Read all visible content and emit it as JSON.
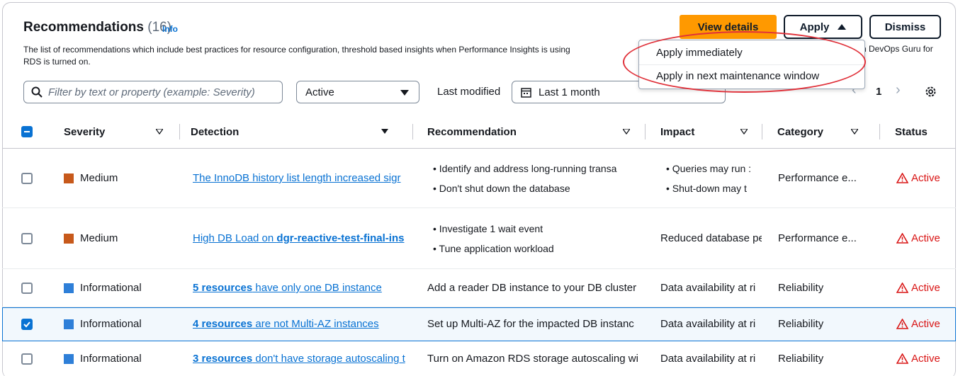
{
  "header": {
    "title": "Recommendations",
    "count": "(16)",
    "info": "Info",
    "description": "The list of recommendations which include best practices for resource configuration, threshold based insights when Performance Insights is using",
    "description_line2": "RDS is turned on.",
    "description_tail": "n DevOps Guru for"
  },
  "actions": {
    "view_details": "View details",
    "apply": "Apply",
    "dismiss": "Dismiss"
  },
  "apply_menu": {
    "items": [
      "Apply immediately",
      "Apply in next maintenance window"
    ]
  },
  "toolbar": {
    "filter_placeholder": "Filter by text or property (example: Severity)",
    "status_select": "Active",
    "last_modified_label": "Last modified",
    "date_range": "Last 1 month",
    "page": "1"
  },
  "columns": [
    "Severity",
    "Detection",
    "Recommendation",
    "Impact",
    "Category",
    "Status"
  ],
  "rows": [
    {
      "checked": false,
      "severity": "Medium",
      "severity_color": "#c7591b",
      "detection_bold": "",
      "detection": "The InnoDB history list length increased sigr",
      "recommendation": [
        "Identify and address long-running transa",
        "Don't shut down the database"
      ],
      "impact": [
        "Queries may run :",
        "Shut-down may t"
      ],
      "category": "Performance e...",
      "status": "Active"
    },
    {
      "checked": false,
      "severity": "Medium",
      "severity_color": "#c7591b",
      "detection_prefix": "High DB Load on ",
      "detection_bold": "dgr-reactive-test-final-ins",
      "recommendation": [
        "Investigate 1 wait event",
        "Tune application workload"
      ],
      "impact": "Reduced database pe",
      "category": "Performance e...",
      "status": "Active"
    },
    {
      "checked": false,
      "severity": "Informational",
      "severity_color": "#2e7fd8",
      "detection_bold": "5 resources",
      "detection": " have only one DB instance",
      "recommendation": "Add a reader DB instance to your DB cluster",
      "impact": "Data availability at ri",
      "category": "Reliability",
      "status": "Active"
    },
    {
      "checked": true,
      "severity": "Informational",
      "severity_color": "#2e7fd8",
      "detection_bold": "4 resources",
      "detection": " are not Multi-AZ instances",
      "recommendation": "Set up Multi-AZ for the impacted DB instanc",
      "impact": "Data availability at ri",
      "category": "Reliability",
      "status": "Active"
    },
    {
      "checked": false,
      "severity": "Informational",
      "severity_color": "#2e7fd8",
      "detection_bold": "3 resources",
      "detection": " don't have storage autoscaling t",
      "recommendation": "Turn on Amazon RDS storage autoscaling wi",
      "impact": "Data availability at ri",
      "category": "Reliability",
      "status": "Active"
    }
  ],
  "colors": {
    "primary": "#ff9900",
    "link": "#0972d3",
    "status_active": "#d91515",
    "medium": "#c7591b",
    "informational": "#2e7fd8"
  }
}
